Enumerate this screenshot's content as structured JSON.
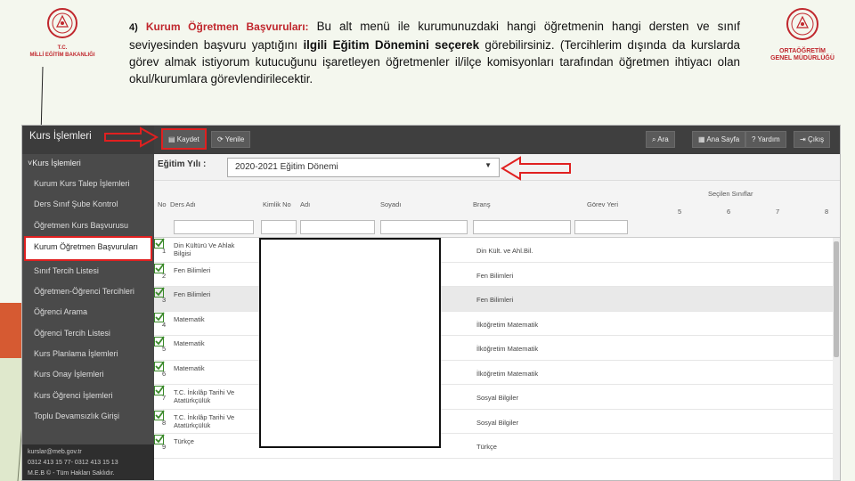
{
  "logos": {
    "left": {
      "caption1": "T.C.",
      "caption2": "MİLLİ EĞİTİM BAKANLIĞI"
    },
    "right": {
      "caption1": "ORTAÖĞRETİM",
      "caption2": "GENEL MÜDÜRLÜĞÜ"
    }
  },
  "description": {
    "number": "4)",
    "title": "Kurum Öğretmen Başvuruları:",
    "text1": " Bu alt menü ile kurumunuzdaki hangi öğretmenin hangi dersten ve sınıf seviyesinden başvuru yaptığını ",
    "bold1": "ilgili Eğitim Dönemini seçerek",
    "text2": " görebilirsiniz. (Tercihlerim dışında da kurslarda görev almak istiyorum kutucuğunu işaretleyen öğretmenler il/ilçe komisyonları tarafından öğretmen ihtiyacı olan okul/kurumlara görevlendirilecektir."
  },
  "colors": {
    "accent_red": "#c0272d",
    "highlight": "#e02020",
    "check_green": "#3a8a2a",
    "sidebar_bg": "#4a4a4a"
  },
  "sidebar": {
    "title": "Kurs İşlemleri",
    "group": "Kurs İşlemleri",
    "items": [
      {
        "label": "Kurum Kurs Talep İşlemleri"
      },
      {
        "label": "Ders Sınıf Şube Kontrol"
      },
      {
        "label": "Öğretmen Kurs Başvurusu"
      },
      {
        "label": "Kurum Öğretmen Başvuruları"
      },
      {
        "label": "Sınıf Tercih Listesi"
      },
      {
        "label": "Öğretmen-Öğrenci Tercihleri"
      },
      {
        "label": "Öğrenci Arama"
      },
      {
        "label": "Öğrenci Tercih Listesi"
      },
      {
        "label": "Kurs Planlama İşlemleri"
      },
      {
        "label": "Kurs Onay İşlemleri"
      },
      {
        "label": "Kurs Öğrenci İşlemleri"
      },
      {
        "label": "Toplu Devamsızlık Girişi"
      }
    ],
    "footer": {
      "email": "kurslar@meb.gov.tr",
      "phone": "0312 413 15 77- 0312 413 15 13",
      "copyright": "M.E.B © - Tüm Hakları Saklıdır."
    }
  },
  "toolbar": {
    "save": "Kaydet",
    "refresh": "Yenile",
    "search": "Ara",
    "home": "Ana Sayfa",
    "help": "Yardım",
    "exit": "Çıkış"
  },
  "filter": {
    "label": "Eğitim Yılı :",
    "value": "2020-2021 Eğitim Dönemi"
  },
  "grid": {
    "headers": {
      "no": "No",
      "ders": "Ders Adı",
      "kimlik": "Kimlik No",
      "adi": "Adı",
      "soyadi": "Soyadı",
      "brans": "Branş",
      "gorev": "Görev Yeri",
      "secilen": "Seçilen Sınıflar"
    },
    "levels": [
      "5",
      "6",
      "7",
      "8"
    ],
    "rows": [
      {
        "no": "1",
        "ders": "Din Kültürü Ve Ahlak Bilgisi",
        "brans": "Din Kült. ve Ahl.Bil."
      },
      {
        "no": "2",
        "ders": "Fen Bilimleri",
        "brans": "Fen Bilimleri"
      },
      {
        "no": "3",
        "ders": "Fen Bilimleri",
        "brans": "Fen Bilimleri"
      },
      {
        "no": "4",
        "ders": "Matematik",
        "brans": "İlköğretim Matematik"
      },
      {
        "no": "5",
        "ders": "Matematik",
        "brans": "İlköğretim Matematik"
      },
      {
        "no": "6",
        "ders": "Matematik",
        "brans": "İlköğretim Matematik"
      },
      {
        "no": "7",
        "ders": "T.C. İnkılâp Tarihi Ve Atatürkçülük",
        "brans": "Sosyal Bilgiler"
      },
      {
        "no": "8",
        "ders": "T.C. İnkılâp Tarihi Ve Atatürkçülük",
        "brans": "Sosyal Bilgiler"
      },
      {
        "no": "9",
        "ders": "Türkçe",
        "brans": "Türkçe"
      }
    ]
  }
}
